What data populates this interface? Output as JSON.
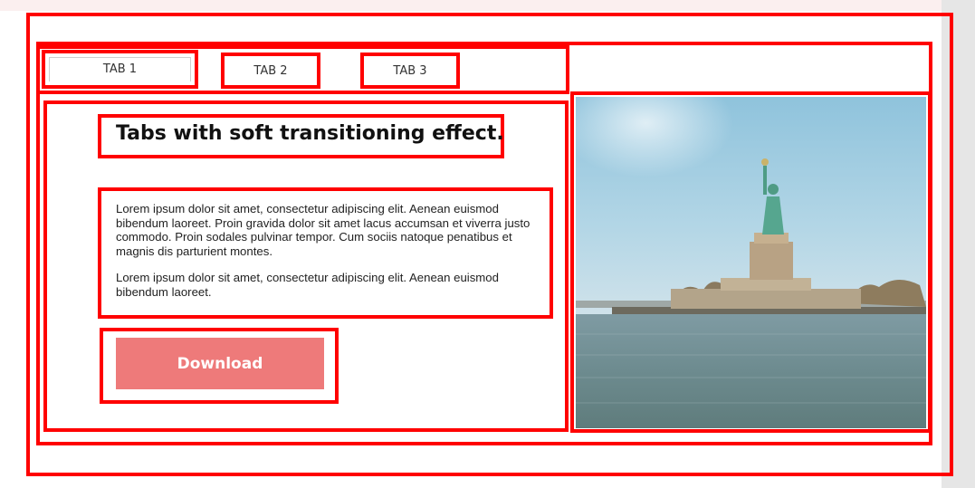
{
  "tabs": [
    {
      "label": "TAB 1",
      "active": true
    },
    {
      "label": "TAB 2",
      "active": false
    },
    {
      "label": "TAB 3",
      "active": false
    }
  ],
  "panel": {
    "title": "Tabs with soft transitioning effect.",
    "paragraphs": [
      "Lorem ipsum dolor sit amet, consectetur adipiscing elit. Aenean euismod bibendum laoreet. Proin gravida dolor sit amet lacus accumsan et viverra justo commodo. Proin sodales pulvinar tempor. Cum sociis natoque penatibus et magnis dis parturient montes.",
      "Lorem ipsum dolor sit amet, consectetur adipiscing elit. Aenean euismod bibendum laoreet."
    ],
    "button_label": "Download"
  },
  "image": {
    "subject": "statue-of-liberty-photo"
  },
  "colors": {
    "accent_button": "#ee7a7a",
    "highlight_border": "#ff0000"
  }
}
